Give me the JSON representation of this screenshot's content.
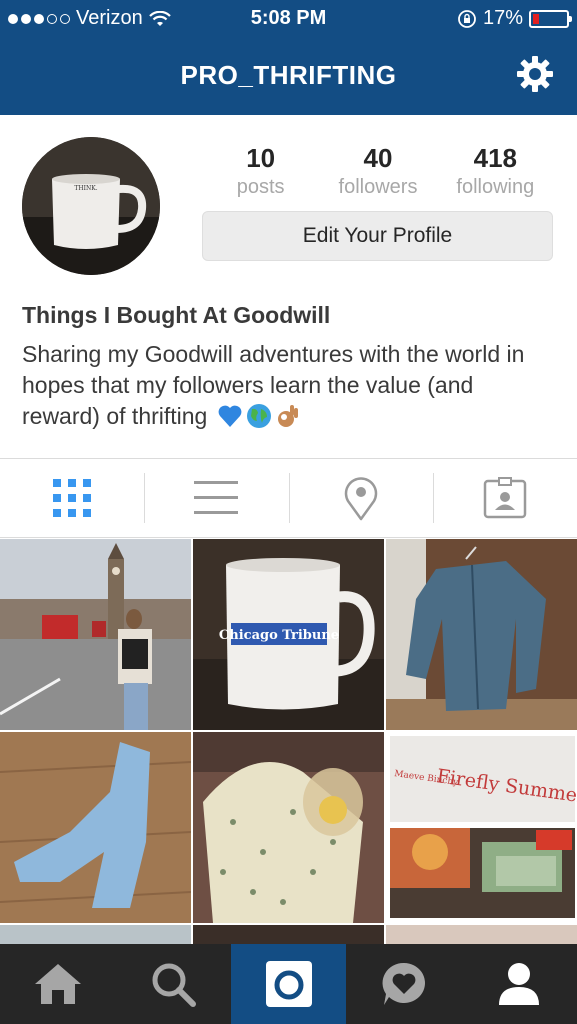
{
  "status_bar": {
    "carrier": "Verizon",
    "time": "5:08 PM",
    "battery": "17%",
    "signal_bars_filled": 3,
    "signal_bars_total": 5,
    "battery_level": 0.17
  },
  "nav": {
    "title": "PRO_THRIFTING",
    "settings_icon": "gear-icon"
  },
  "profile": {
    "posts_count": "10",
    "posts_label": "posts",
    "followers_count": "40",
    "followers_label": "followers",
    "following_count": "418",
    "following_label": "following",
    "edit_button": "Edit Your Profile",
    "avatar_mug_text": "THINK.",
    "name": "Things I Bought At Goodwill",
    "bio": "Sharing my Goodwill adventures with the world in hopes that my followers learn the value (and reward) of thrifting"
  },
  "view_tabs": [
    {
      "name": "grid-view-icon",
      "active": true
    },
    {
      "name": "list-view-icon",
      "active": false
    },
    {
      "name": "location-pin-icon",
      "active": false
    },
    {
      "name": "tagged-photos-icon",
      "active": false
    }
  ],
  "photos": {
    "mug_label": "Chicago Tribune",
    "book_title": "Firefly Summer",
    "book_author": "Maeve Binchy"
  },
  "bottom_tabs": [
    {
      "name": "home-icon",
      "active": false
    },
    {
      "name": "search-icon",
      "active": false
    },
    {
      "name": "camera-icon",
      "active": true
    },
    {
      "name": "activity-heart-icon",
      "active": false
    },
    {
      "name": "profile-icon",
      "active": false
    }
  ],
  "colors": {
    "brand_blue": "#134d84",
    "active_tab_blue": "#3897f0",
    "bottom_bar": "#262626"
  }
}
